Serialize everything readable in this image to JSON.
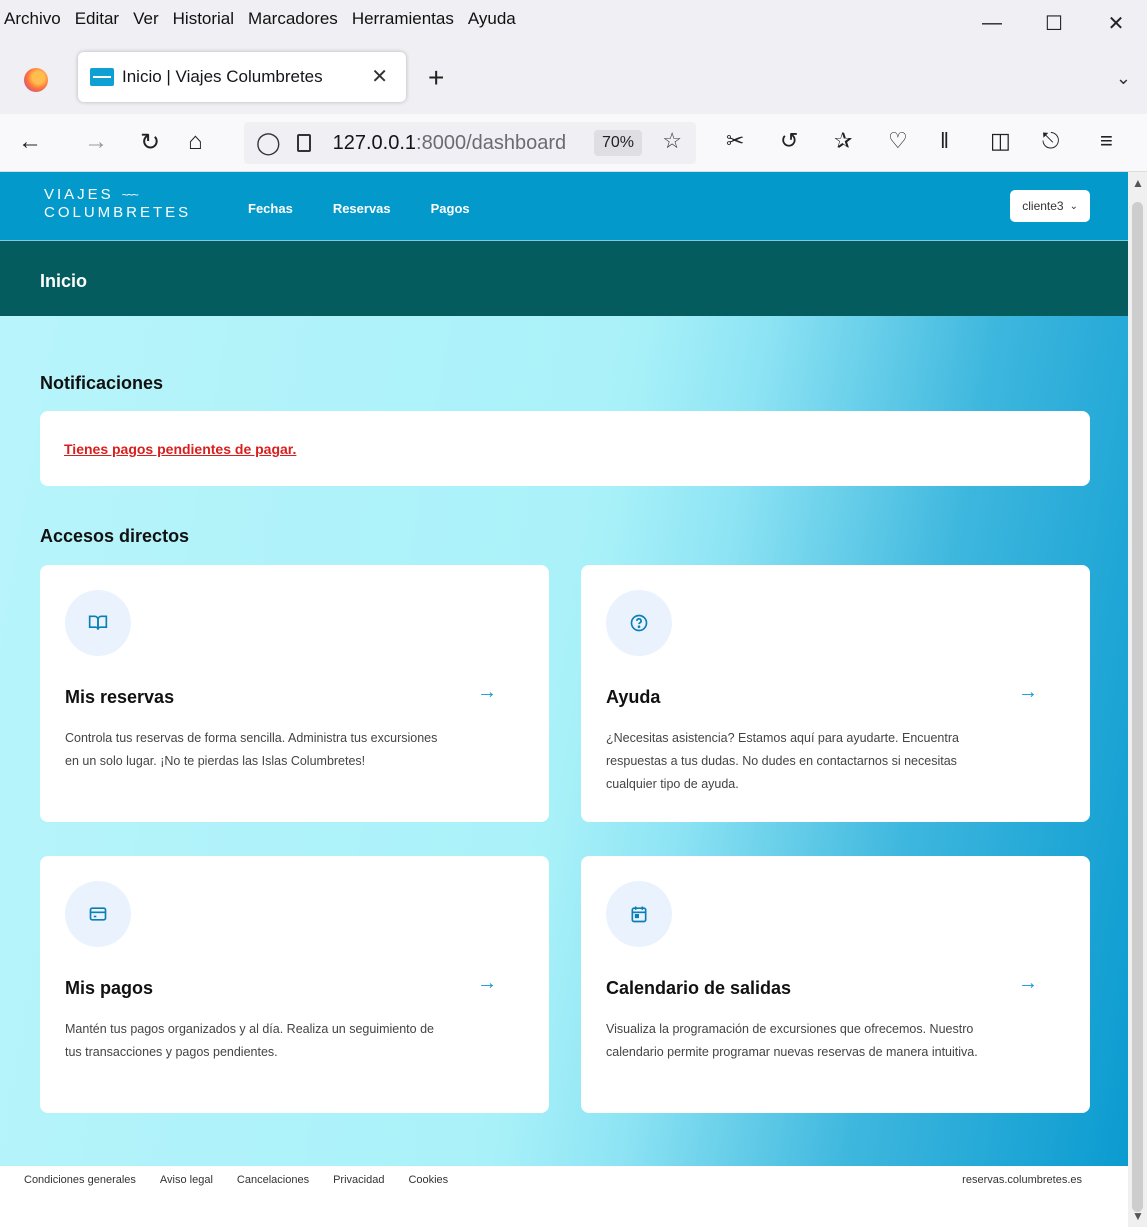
{
  "browser": {
    "menu": [
      "Archivo",
      "Editar",
      "Ver",
      "Historial",
      "Marcadores",
      "Herramientas",
      "Ayuda"
    ],
    "tab_title": "Inicio | Viajes Columbretes",
    "url_host": "127.0.0.1",
    "url_path": ":8000/dashboard",
    "zoom": "70%"
  },
  "header": {
    "logo_line1": "VIAJES",
    "logo_line2": "COLUMBRETES",
    "nav": [
      "Fechas",
      "Reservas",
      "Pagos"
    ],
    "user": "cliente3"
  },
  "page": {
    "title": "Inicio",
    "notifications_title": "Notificaciones",
    "notification_link": "Tienes pagos pendientes de pagar.",
    "shortcuts_title": "Accesos directos"
  },
  "cards": [
    {
      "icon": "book-open-icon",
      "title": "Mis reservas",
      "text": "Controla tus reservas de forma sencilla. Administra tus excursiones en un solo lugar. ¡No te pierdas las Islas Columbretes!"
    },
    {
      "icon": "help-circle-icon",
      "title": "Ayuda",
      "text": "¿Necesitas asistencia? Estamos aquí para ayudarte. Encuentra respuestas a tus dudas. No dudes en contactarnos si necesitas cualquier tipo de ayuda."
    },
    {
      "icon": "credit-card-icon",
      "title": "Mis pagos",
      "text": "Mantén tus pagos organizados y al día. Realiza un seguimiento de tus transacciones y pagos pendientes."
    },
    {
      "icon": "calendar-icon",
      "title": "Calendario de salidas",
      "text": "Visualiza la programación de excursiones que ofrecemos. Nuestro calendario permite programar nuevas reservas de manera intuitiva."
    }
  ],
  "footer": {
    "links": [
      "Condiciones generales",
      "Aviso legal",
      "Cancelaciones",
      "Privacidad",
      "Cookies"
    ],
    "domain": "reservas.columbretes.es"
  },
  "colors": {
    "header": "#0399cb",
    "subheader": "#055c5e",
    "accent": "#0a9ad2",
    "alert": "#d91e1e"
  }
}
